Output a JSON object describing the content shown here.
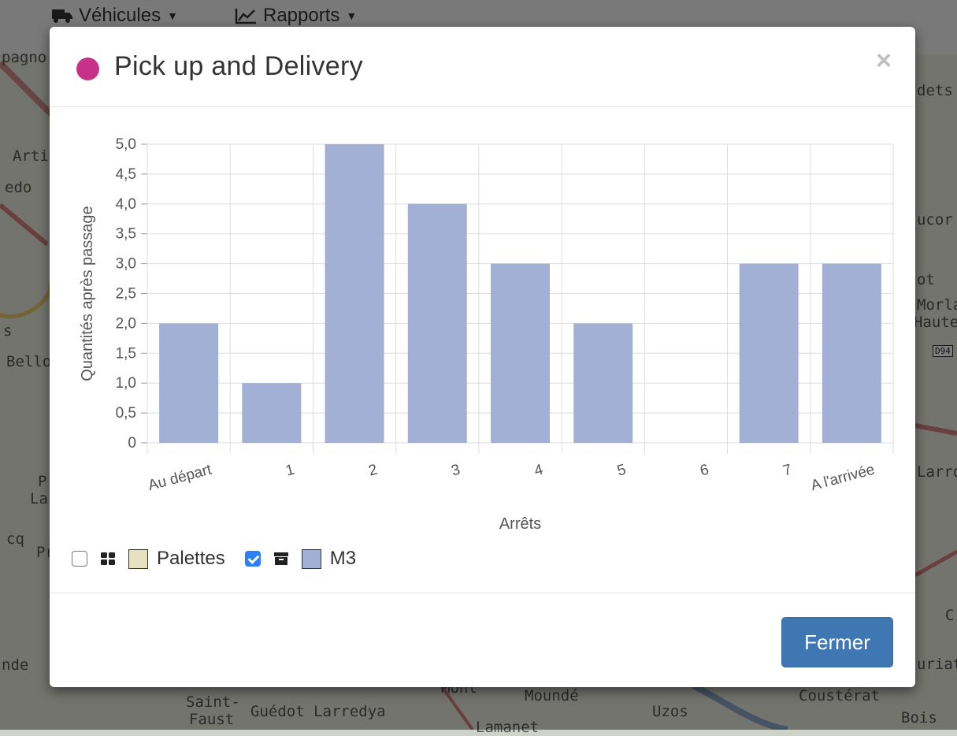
{
  "navbar": {
    "items": [
      {
        "label": "Véhicules",
        "icon": "truck-icon"
      },
      {
        "label": "Rapports",
        "icon": "line-chart-icon"
      }
    ]
  },
  "map": {
    "labels": [
      "pagno",
      "Artia",
      "edo",
      "s",
      "Bello",
      "P",
      "La",
      "cq",
      "Pr",
      "nde",
      "Saint-",
      "Faust",
      "Guédot Larredya",
      "Mont",
      "Moundé",
      "Uzos",
      "Lamanet",
      "Coustérat",
      "Bois",
      "dets",
      "ucor",
      "ot",
      "Morla",
      "Haute",
      "Larro",
      "uriat",
      "C"
    ],
    "road_badge": "D94"
  },
  "modal": {
    "title": "Pick up and Delivery",
    "status_color": "#c8318a",
    "close_symbol": "×",
    "footer": {
      "close_label": "Fermer"
    }
  },
  "legend": {
    "items": [
      {
        "checked": false,
        "icon": "th-large-icon",
        "swatch": "#e7e0c1",
        "label": "Palettes"
      },
      {
        "checked": true,
        "icon": "archive-icon",
        "swatch": "#a3b0d5",
        "label": "M3"
      }
    ]
  },
  "chart_data": {
    "type": "bar",
    "categories": [
      "Au départ",
      "1",
      "2",
      "3",
      "4",
      "5",
      "6",
      "7",
      "A l'arrivée"
    ],
    "series": [
      {
        "name": "M3",
        "color": "#a3b0d5",
        "values": [
          2,
          1,
          5,
          4,
          3,
          2,
          0,
          3,
          3
        ]
      }
    ],
    "ylabel": "Quantités après passage",
    "xlabel": "Arrêts",
    "ylim": [
      0,
      5
    ],
    "yticks": [
      "0",
      "0,5",
      "1,0",
      "1,5",
      "2,0",
      "2,5",
      "3,0",
      "3,5",
      "4,0",
      "4,5",
      "5,0"
    ],
    "grid": true
  }
}
